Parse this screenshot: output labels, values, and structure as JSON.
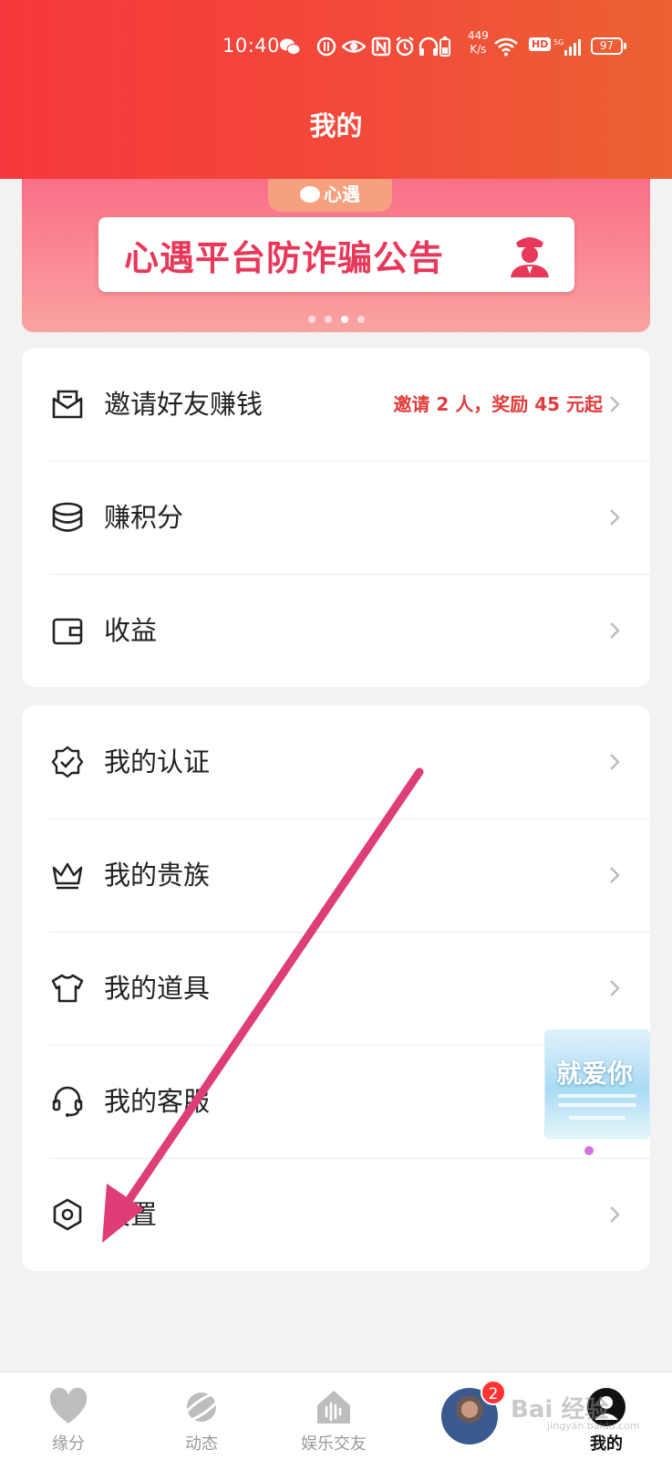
{
  "status_bar": {
    "time": "10:40",
    "net_speed_value": "449",
    "net_speed_unit": "K/s",
    "hd": "HD",
    "battery": "97"
  },
  "header": {
    "title": "我的",
    "color_start": "#f7383c",
    "color_end": "#ec6232"
  },
  "banner": {
    "brand": "心遇",
    "title": "心遇平台防诈骗公告",
    "dots": 4,
    "active_dot": 3
  },
  "earn_section": {
    "items": [
      {
        "icon": "envelope-icon",
        "label": "邀请好友赚钱",
        "extra": "邀请 2 人，奖励 45 元起"
      },
      {
        "icon": "coins-icon",
        "label": "赚积分"
      },
      {
        "icon": "wallet-icon",
        "label": "收益"
      }
    ]
  },
  "account_section": {
    "items": [
      {
        "icon": "verified-badge-icon",
        "label": "我的认证"
      },
      {
        "icon": "crown-icon",
        "label": "我的贵族"
      },
      {
        "icon": "tshirt-icon",
        "label": "我的道具"
      },
      {
        "icon": "headset-icon",
        "label": "我的客服"
      },
      {
        "icon": "hexagon-settings-icon",
        "label": "设置"
      }
    ]
  },
  "float_ad": {
    "title": "就爱你"
  },
  "tabbar": {
    "tabs": [
      {
        "icon": "heart-icon",
        "label": "缘分"
      },
      {
        "icon": "planet-icon",
        "label": "动态"
      },
      {
        "icon": "house-audio-icon",
        "label": "娱乐交友"
      },
      {
        "icon": "avatar",
        "label": "",
        "badge": "2"
      },
      {
        "icon": "profile-icon",
        "label": "我的",
        "active": true
      }
    ]
  },
  "watermark": {
    "text": "Bai 经验",
    "sub": "jingyan.baidu.com"
  }
}
